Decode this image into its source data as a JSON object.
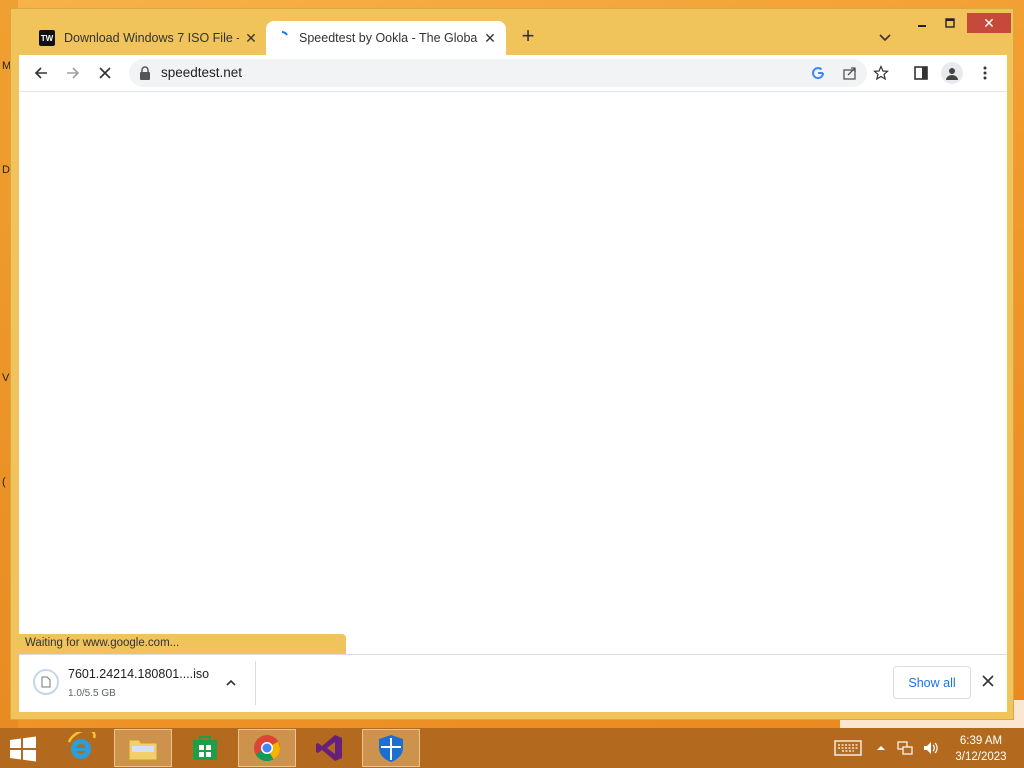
{
  "desktop": {
    "edge_letters": [
      "M",
      "D",
      "V",
      "("
    ]
  },
  "browser": {
    "tabs": [
      {
        "title": "Download Windows 7 ISO File - U",
        "favicon": "tw-logo",
        "active": false
      },
      {
        "title": "Speedtest by Ookla - The Global",
        "favicon": "loading-spinner",
        "active": true
      }
    ],
    "window_controls": {
      "minimize": "minimize-icon",
      "maximize": "maximize-icon",
      "close": "close-icon"
    },
    "toolbar": {
      "url": "speedtest.net",
      "reload_state": "stop-loading"
    },
    "status_text": "Waiting for www.google.com...",
    "download": {
      "filename": "7601.24214.180801....iso",
      "progress": "1.0/5.5 GB",
      "show_all_label": "Show all"
    }
  },
  "taskbar": {
    "apps": [
      "file-explorer",
      "internet-explorer",
      "windows-store",
      "chrome",
      "visual-studio",
      "windows-defender"
    ],
    "clock": {
      "time": "6:39 AM",
      "date": "3/12/2023"
    }
  },
  "colors": {
    "window_frame": "#f1c35b",
    "taskbar": "#b36a1e",
    "close_button": "#c7493b",
    "link_blue": "#1a73e8"
  }
}
